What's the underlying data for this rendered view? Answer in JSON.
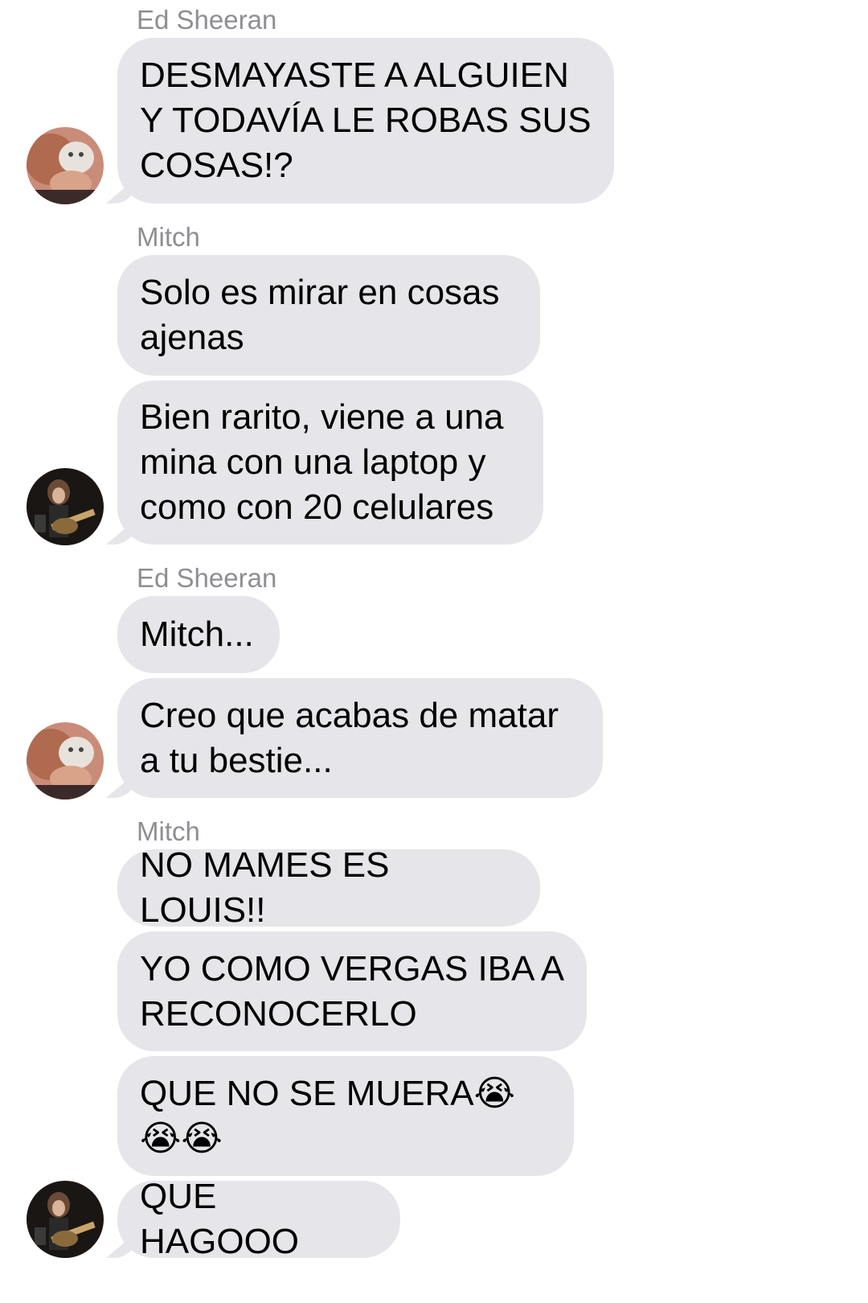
{
  "conversation": {
    "groups": [
      {
        "sender": "Ed Sheeran",
        "avatar_icon": "ed-sheeran-avatar",
        "messages": [
          "DESMAYASTE A ALGUIEN Y TODAVÍA LE ROBAS SUS COSAS!?"
        ]
      },
      {
        "sender": "Mitch",
        "avatar_icon": "mitch-avatar",
        "messages": [
          "Solo es mirar en cosas ajenas",
          "Bien rarito, viene a una mina con una laptop y como con 20 celulares"
        ]
      },
      {
        "sender": "Ed Sheeran",
        "avatar_icon": "ed-sheeran-avatar",
        "messages": [
          "Mitch...",
          "Creo que acabas de matar a tu bestie..."
        ]
      },
      {
        "sender": "Mitch",
        "avatar_icon": "mitch-avatar",
        "messages": [
          "NO MAMES ES LOUIS!!",
          "YO COMO VERGAS IBA A RECONOCERLO",
          "QUE NO SE MUERA😭😭😭",
          "QUE HAGOOO"
        ]
      }
    ]
  },
  "colors": {
    "bubble": "#e5e5ea",
    "sender_name": "#8e8e93",
    "text": "#000000"
  }
}
